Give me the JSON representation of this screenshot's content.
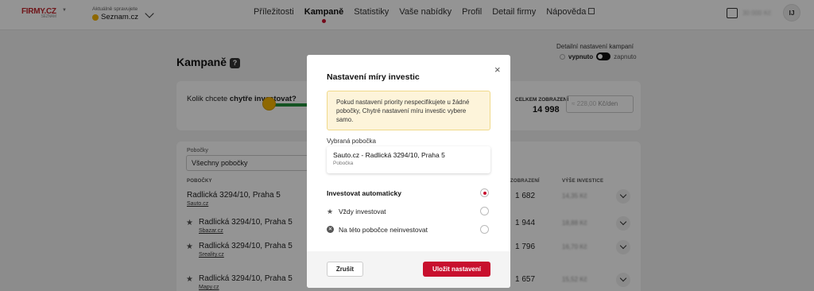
{
  "header": {
    "logo_text": "FIRMY.CZ",
    "logo_sub": "SEZNAM",
    "account_label": "Aktuálně spravujete",
    "account_name": "Seznam.cz",
    "nav": [
      {
        "label": "Příležitosti"
      },
      {
        "label": "Kampaně",
        "active": true
      },
      {
        "label": "Statistiky"
      },
      {
        "label": "Vaše nabídky"
      },
      {
        "label": "Profil"
      },
      {
        "label": "Detail firmy"
      },
      {
        "label": "Nápověda",
        "external": true
      }
    ],
    "wallet_amount": "30 000 Kč",
    "user_initials": "IJ"
  },
  "page": {
    "title": "Kampaně",
    "help_badge": "?",
    "advanced_label": "Detailní nastavení kampaní",
    "advanced_off": "vypnuto",
    "advanced_on": "zapnuto",
    "question_prefix": "Kolik chcete",
    "question_bold": "chytře investovat?",
    "total_views_label": "CELKEM ZOBRAZENÍ",
    "total_views_value": "14 998",
    "budget_value": "≈ 228,00",
    "budget_unit": "Kč/den",
    "filter_label": "Pobočky",
    "filter_value": "Všechny pobočky",
    "columns": {
      "branches": "POBOČKY",
      "views": "ZOBRAZENÍ",
      "investment": "VÝŠE INVESTICE"
    },
    "rows": [
      {
        "name": "Radlická 3294/10, Praha 5",
        "source": "Sauto.cz",
        "views": "1 682",
        "investment": "14,35 Kč",
        "starred": false
      },
      {
        "name": "Radlická 3294/10, Praha 5",
        "source": "Sbazar.cz",
        "views": "1 944",
        "investment": "18,88 Kč",
        "starred": true
      },
      {
        "name": "Radlická 3294/10, Praha 5",
        "source": "Sreality.cz",
        "views": "1 796",
        "investment": "16,70 Kč",
        "starred": true
      },
      {
        "name": "Radlická 3294/10, Praha 5",
        "source": "Mapy.cz",
        "views": "1 657",
        "investment": "15,52 Kč",
        "starred": true
      }
    ]
  },
  "modal": {
    "title": "Nastavení míry investic",
    "close_glyph": "×",
    "warning": "Pokud nastavení priority nespecifikujete u žádné pobočky, Chytré nastavení míru investic vybere samo.",
    "selected_label": "Vybraná pobočka",
    "selected_name": "Sauto.cz - Radlická 3294/10, Praha 5",
    "selected_sub": "Pobočka",
    "options": [
      {
        "label": "Investovat automaticky",
        "selected": true,
        "icon": ""
      },
      {
        "label": "Vždy investovat",
        "selected": false,
        "icon": "star-icon"
      },
      {
        "label": "Na této pobočce neinvestovat",
        "selected": false,
        "icon": "cross-circle-icon"
      }
    ],
    "cancel_label": "Zrušit",
    "save_label": "Uložit nastavení"
  },
  "colors": {
    "accent": "#c8102e",
    "warning_bg": "#fdf4da",
    "slider_green": "#23913c"
  }
}
